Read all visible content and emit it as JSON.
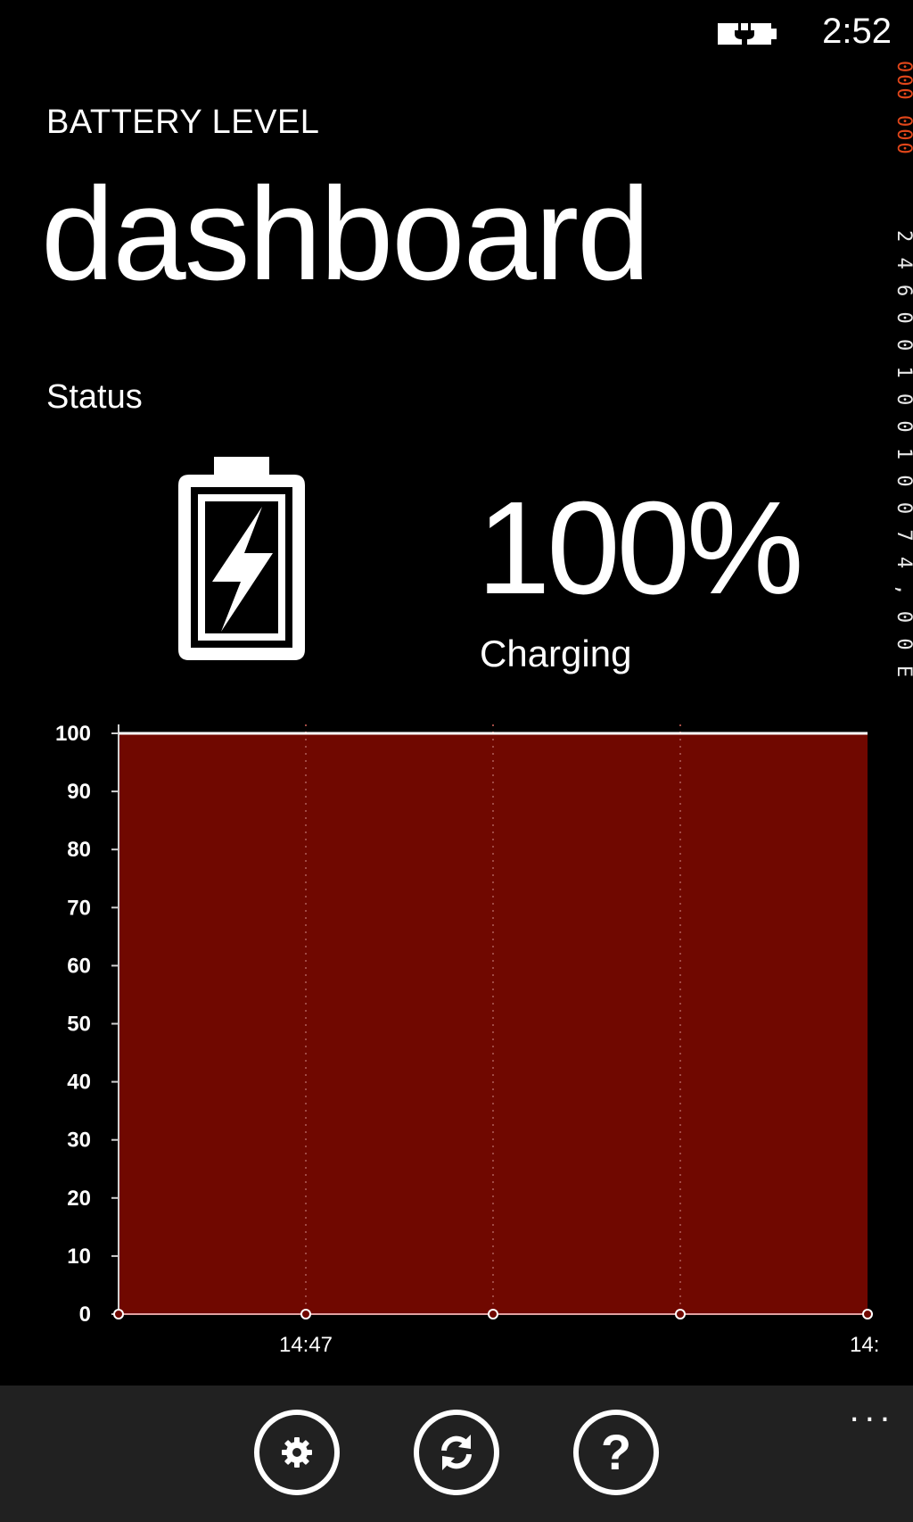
{
  "status_bar": {
    "time": "2:52",
    "battery_icon": "battery-charging-icon"
  },
  "debug_counter": {
    "red_text": "000 000",
    "white_text": "2 4 6 0 0   1 0 0   1 0 0   7 4 , 0 0   E"
  },
  "header": {
    "app_title": "BATTERY LEVEL",
    "page_title": "dashboard"
  },
  "status": {
    "label": "Status",
    "icon": "battery-charging-icon",
    "percent": "100%",
    "state": "Charging"
  },
  "chart_data": {
    "type": "area",
    "title": "",
    "xlabel": "",
    "ylabel": "",
    "ylim": [
      0,
      100
    ],
    "yticks": [
      0,
      10,
      20,
      30,
      40,
      50,
      60,
      70,
      80,
      90,
      100
    ],
    "xtick_labels": [
      "14:47",
      "14:"
    ],
    "series": [
      {
        "values": [
          100,
          100,
          100,
          100,
          100
        ]
      }
    ],
    "grid": "vertical dotted",
    "colors": {
      "fill": "#700800",
      "line": "#ffffff",
      "axis": "#cfcfcf"
    }
  },
  "app_bar": {
    "more": "...",
    "buttons": [
      {
        "name": "settings",
        "icon": "gear-icon"
      },
      {
        "name": "refresh",
        "icon": "refresh-icon"
      },
      {
        "name": "help",
        "icon": "help-icon",
        "glyph": "?"
      }
    ]
  }
}
